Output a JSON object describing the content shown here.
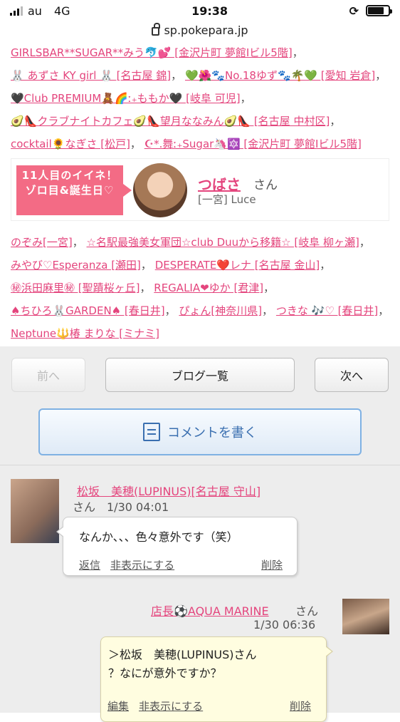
{
  "status": {
    "carrier": "au",
    "network": "4G",
    "time": "19:38"
  },
  "url": "sp.pokepara.jp",
  "likes_top": [
    "GIRLSBAR**SUGAR**みう🐬💕 [金沢片町 夢館Ⅰビル5階]",
    "🐰 あずさ KY girl 🐰 [名古屋 錦]",
    "💚🌺🐾No.18ゆず🐾🌴💚 [愛知 岩倉]",
    "🖤Club PREMIUM🧸🌈ː₊ももか🖤 [岐阜 可児]",
    "🥑👠クラブナイトカフェ🥑👠望月ななみん🥑👠 [名古屋 中村区]",
    "cocktail🌻なぎさ [松戸]",
    "☪︎*.舞ː₊Sugar🦄🔯 [金沢片町 夢館Ⅰビル5階]"
  ],
  "featured": {
    "banner_line1": "11人目のイイネ！",
    "banner_line2": "ゾロ目&誕生日♡",
    "name": "つばさ",
    "suffix": "さん",
    "shop": "[一宮] Luce"
  },
  "likes_bottom": [
    "のぞみ[一宮]",
    "☆名駅最強美女軍団☆club Duuから移籍☆ [岐阜 柳ヶ瀬]",
    "みやび♡Esperanza [瀬田]",
    "DESPERATE❤️レナ [名古屋 金山]",
    "㊙浜田麻里㊙ [聖蹟桜ヶ丘]",
    "REGALIA❤ゆか [君津]",
    "♠ちひろ🐰GARDEN♠ [春日井]",
    "ぴょん[神奈川県]",
    "つきな 🎶♡ [春日井]",
    "Neptune🔱椿 まりな [ミナミ]"
  ],
  "nav": {
    "prev": "前へ",
    "list": "ブログ一覧",
    "next": "次へ"
  },
  "comment_button": "コメントを書く",
  "comments": [
    {
      "name": "松坂　美穂(LUPINUS)[名古屋 守山]",
      "meta": "さん　1/30 04:01",
      "text": "なんか、、、色々意外です（笑）",
      "actions": [
        "返信",
        "非表示にする",
        "削除"
      ]
    },
    {
      "name": "店長⚽AQUA MARINE",
      "suffix": "さん",
      "time": "1/30 06:36",
      "line1": "＞松坂　美穂(LUPINUS)さん",
      "line2": "？なにが意外ですか？",
      "actions": [
        "編集",
        "非表示にする",
        "削除"
      ]
    }
  ]
}
